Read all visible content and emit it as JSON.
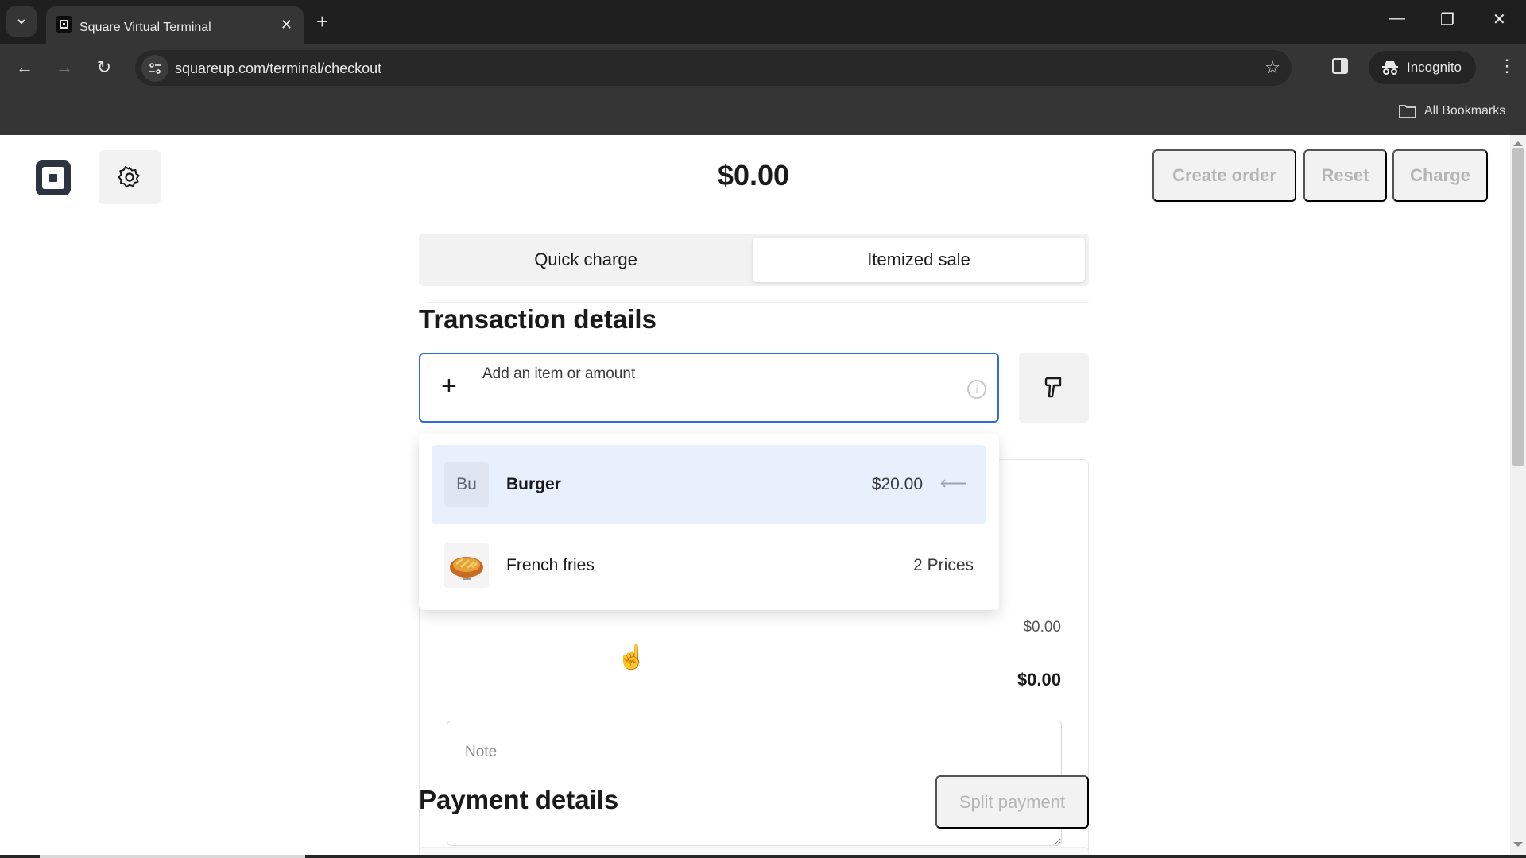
{
  "browser": {
    "tab_title": "Square Virtual Terminal",
    "new_tab_label": "+",
    "url": "squareup.com/terminal/checkout",
    "profile_label": "Incognito",
    "bookmarks_label": "All Bookmarks",
    "minimize": "—",
    "restore": "❐",
    "close": "✕"
  },
  "header": {
    "total": "$0.00",
    "buttons": {
      "create_order": "Create order",
      "reset": "Reset",
      "charge": "Charge"
    }
  },
  "mode_tabs": [
    {
      "label": "Quick charge",
      "active": false
    },
    {
      "label": "Itemized sale",
      "active": true
    }
  ],
  "transaction": {
    "title": "Transaction details",
    "item_input_placeholder": "Add an item or amount",
    "item_input_value": "",
    "subtotal": "$0.00",
    "total": "$0.00",
    "note_placeholder": "Note"
  },
  "dropdown": {
    "items": [
      {
        "thumb_text": "Bu",
        "name": "Burger",
        "price": "$20.00",
        "highlighted": true,
        "enter_icon": "↵"
      },
      {
        "thumb_text": "",
        "name": "French fries",
        "price": "2 Prices",
        "highlighted": false
      }
    ]
  },
  "payment": {
    "title": "Payment details",
    "split_label": "Split payment"
  },
  "scroll": {
    "position_fraction": 0.0,
    "visible_fraction": 0.45
  },
  "video_progress": {
    "fraction": 0.2
  }
}
